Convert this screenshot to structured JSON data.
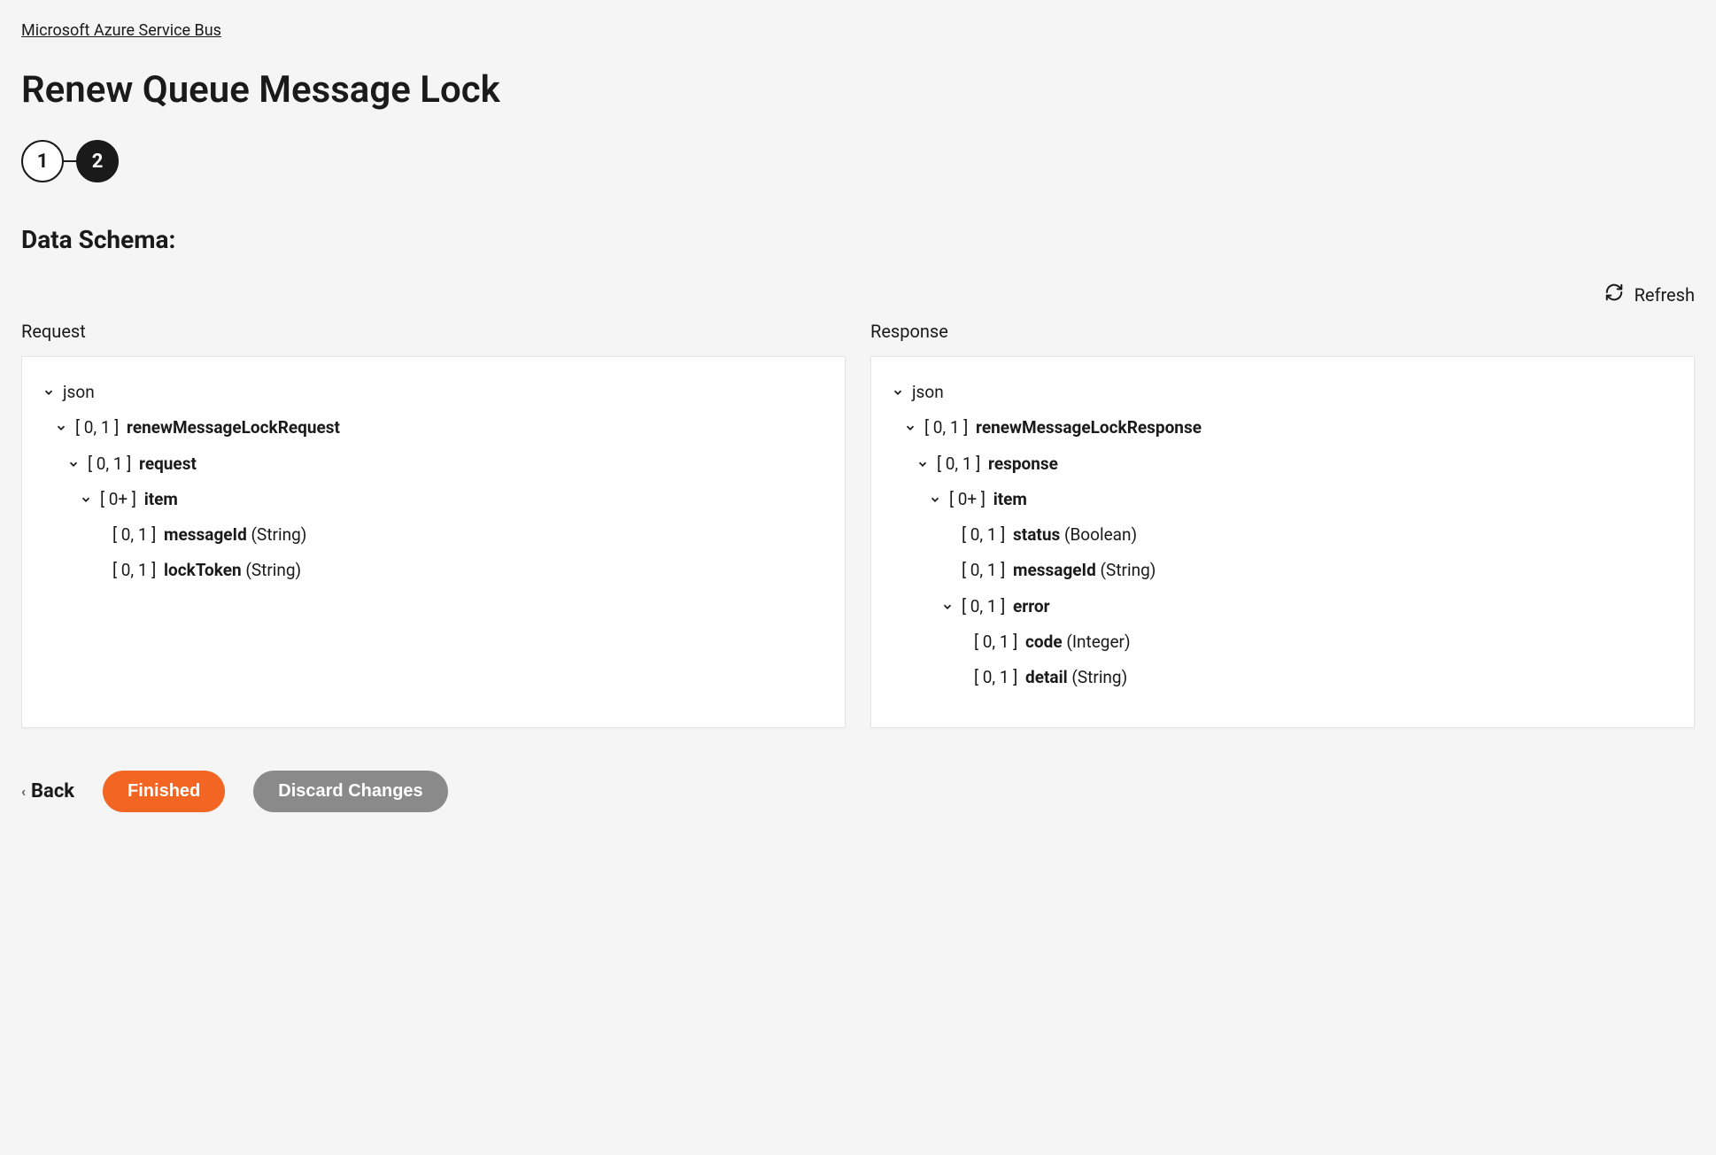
{
  "breadcrumb": {
    "parent_label": "Microsoft Azure Service Bus"
  },
  "page": {
    "title": "Renew Queue Message Lock"
  },
  "stepper": {
    "step1": "1",
    "step2": "2"
  },
  "section": {
    "title": "Data Schema:"
  },
  "refresh": {
    "label": "Refresh"
  },
  "columns": {
    "request_label": "Request",
    "response_label": "Response"
  },
  "request_tree": {
    "root": "json",
    "n1_card": "[ 0, 1 ]",
    "n1_name": "renewMessageLockRequest",
    "n2_card": "[ 0, 1 ]",
    "n2_name": "request",
    "n3_card": "[ 0+ ]",
    "n3_name": "item",
    "n4_card": "[ 0, 1 ]",
    "n4_name": "messageId",
    "n4_type": "(String)",
    "n5_card": "[ 0, 1 ]",
    "n5_name": "lockToken",
    "n5_type": "(String)"
  },
  "response_tree": {
    "root": "json",
    "n1_card": "[ 0, 1 ]",
    "n1_name": "renewMessageLockResponse",
    "n2_card": "[ 0, 1 ]",
    "n2_name": "response",
    "n3_card": "[ 0+ ]",
    "n3_name": "item",
    "n4_card": "[ 0, 1 ]",
    "n4_name": "status",
    "n4_type": "(Boolean)",
    "n5_card": "[ 0, 1 ]",
    "n5_name": "messageId",
    "n5_type": "(String)",
    "n6_card": "[ 0, 1 ]",
    "n6_name": "error",
    "n7_card": "[ 0, 1 ]",
    "n7_name": "code",
    "n7_type": "(Integer)",
    "n8_card": "[ 0, 1 ]",
    "n8_name": "detail",
    "n8_type": "(String)"
  },
  "footer": {
    "back_label": "Back",
    "finished_label": "Finished",
    "discard_label": "Discard Changes"
  }
}
